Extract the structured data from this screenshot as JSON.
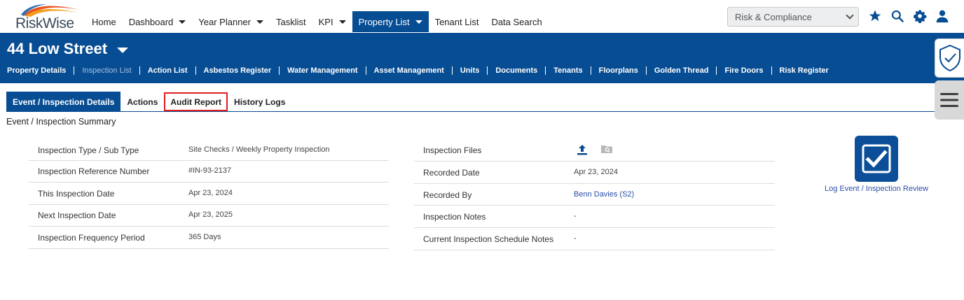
{
  "brand": {
    "name": "RiskWise"
  },
  "nav": {
    "items": [
      {
        "label": "Home",
        "dropdown": false,
        "active": false
      },
      {
        "label": "Dashboard",
        "dropdown": true,
        "active": false
      },
      {
        "label": "Year Planner",
        "dropdown": true,
        "active": false
      },
      {
        "label": "Tasklist",
        "dropdown": false,
        "active": false
      },
      {
        "label": "KPI",
        "dropdown": true,
        "active": false
      },
      {
        "label": "Property List",
        "dropdown": true,
        "active": true
      },
      {
        "label": "Tenant List",
        "dropdown": false,
        "active": false
      },
      {
        "label": "Data Search",
        "dropdown": false,
        "active": false
      }
    ],
    "module_select": "Risk & Compliance"
  },
  "property": {
    "title": "44 Low Street",
    "subnav": [
      "Property Details",
      "Inspection List",
      "Action List",
      "Asbestos Register",
      "Water Management",
      "Asset Management",
      "Units",
      "Documents",
      "Tenants",
      "Floorplans",
      "Golden Thread",
      "Fire Doors",
      "Risk Register"
    ],
    "subnav_active": "Inspection List"
  },
  "tabs": {
    "items": [
      "Event / Inspection Details",
      "Actions",
      "Audit Report",
      "History Logs"
    ],
    "active": "Event / Inspection Details",
    "highlighted": "Audit Report"
  },
  "summary": {
    "title": "Event / Inspection Summary",
    "left": [
      {
        "label": "Inspection Type / Sub Type",
        "value": "Site Checks / Weekly Property Inspection"
      },
      {
        "label": "Inspection Reference Number",
        "value": "#IN-93-2137"
      },
      {
        "label": "This Inspection Date",
        "value": "Apr 23, 2024"
      },
      {
        "label": "Next Inspection Date",
        "value": "Apr 23, 2025"
      },
      {
        "label": "Inspection Frequency Period",
        "value": "365 Days"
      }
    ],
    "right": [
      {
        "label": "Inspection Files",
        "value": ""
      },
      {
        "label": "Recorded Date",
        "value": "Apr 23, 2024"
      },
      {
        "label": "Recorded By",
        "value": "Benn Davies (S2)"
      },
      {
        "label": "Inspection Notes",
        "value": "-"
      },
      {
        "label": "Current Inspection Schedule Notes",
        "value": "-"
      }
    ],
    "review_label": "Log Event / Inspection Review"
  },
  "colors": {
    "primary": "#074d93",
    "highlight": "#e01e1e",
    "link": "#2b4fa5"
  }
}
